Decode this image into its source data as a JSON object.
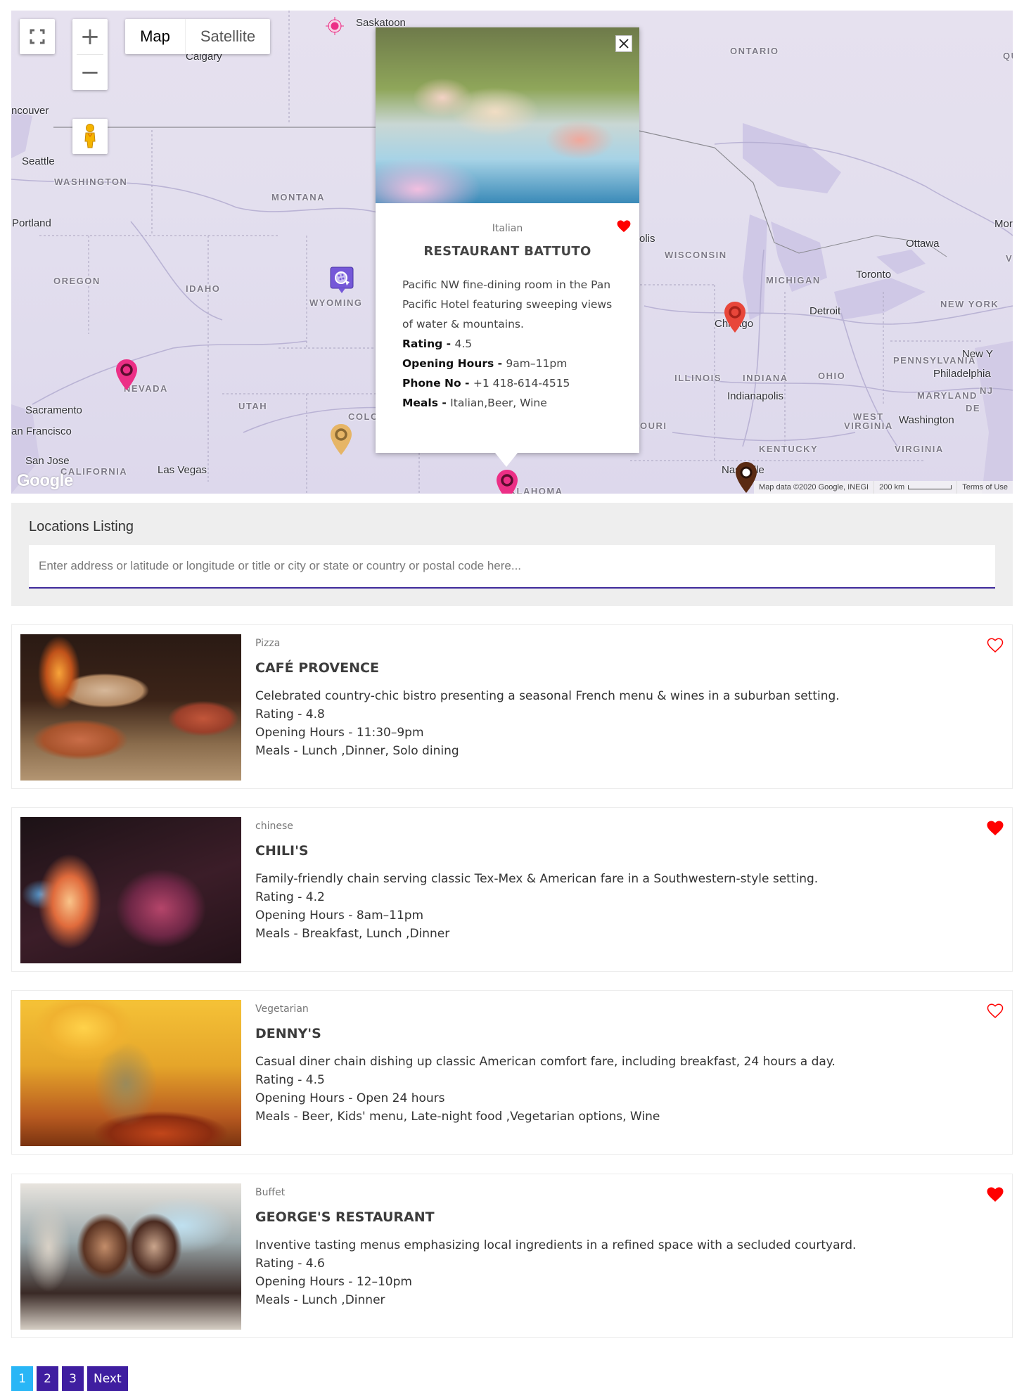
{
  "map": {
    "controls": {
      "fullscreen_icon": "fullscreen-icon",
      "zoom_in_label": "+",
      "zoom_out_label": "−",
      "pegman_icon": "street-view-pegman-icon",
      "map_type": {
        "active": "Map",
        "inactive": "Satellite"
      }
    },
    "labels": {
      "states": [
        "WASHINGTON",
        "MONTANA",
        "OREGON",
        "IDAHO",
        "WYOMING",
        "NEVADA",
        "UTAH",
        "COLO",
        "CALIFORNIA",
        "ONTARIO",
        "QU",
        "WISCONSIN",
        "MICHIGAN",
        "NEW YORK",
        "PENNSYLVANIA",
        "ILLINOIS",
        "INDIANA",
        "OHIO",
        "MARYLAND",
        "NJ",
        "DE",
        "WEST",
        "VIRGINIA",
        "KENTUCKY",
        "VIRGINIA",
        "V",
        "OKLAHOMA",
        "OURI"
      ],
      "cities": [
        "Saskatoon",
        "Calgary",
        "ncouver",
        "Seattle",
        "Portland",
        "Sacramento",
        "an Francisco",
        "San Jose",
        "Las Vegas",
        "Ottawa",
        "Mor",
        "Toronto",
        "Detroit",
        "Chicago",
        "Indianapolis",
        "Philadelphia",
        "New Y",
        "Washington",
        "Nashville",
        "olis"
      ]
    },
    "markers": [
      {
        "name": "pink-pin-nevada",
        "color": "#ec2f86"
      },
      {
        "name": "pizza-pin-wyoming",
        "color": "#7558d8"
      },
      {
        "name": "gold-pin-colorado",
        "color": "#e6b566"
      },
      {
        "name": "red-pin-chicago",
        "color": "#e8463a"
      },
      {
        "name": "brown-pin-nashville",
        "color": "#5a2a12"
      },
      {
        "name": "pink-pin-oklahoma",
        "color": "#ec2f86"
      },
      {
        "name": "pink-target-saskatchewan",
        "color": "#ec2f86"
      }
    ],
    "logo": "Google",
    "footer": {
      "attribution": "Map data ©2020 Google, INEGI",
      "scale": "200 km",
      "terms": "Terms of Use"
    }
  },
  "popup": {
    "category": "Italian",
    "title": "RESTAURANT BATTUTO",
    "description": "Pacific NW fine-dining room in the Pan Pacific Hotel featuring sweeping views of water & mountains.",
    "fields": [
      {
        "label": "Rating - ",
        "value": "4.5"
      },
      {
        "label": "Opening Hours - ",
        "value": "9am–11pm"
      },
      {
        "label": "Phone No - ",
        "value": "+1 418-614-4515"
      },
      {
        "label": "Meals - ",
        "value": "Italian,Beer, Wine"
      }
    ],
    "favorite": true
  },
  "listing": {
    "title": "Locations Listing",
    "search_placeholder": "Enter address or latitude or longitude or title or city or state or country or postal code here...",
    "search_value": ""
  },
  "locations": [
    {
      "category": "Pizza",
      "title": "CAFÉ PROVENCE",
      "description": "Celebrated country-chic bistro presenting a seasonal French menu & wines in a suburban setting.",
      "rating": "Rating - 4.8",
      "hours": "Opening Hours - 11:30–9pm",
      "meals": "Meals - Lunch ,Dinner, Solo dining",
      "favorite": false
    },
    {
      "category": "chinese",
      "title": "CHILI'S",
      "description": "Family-friendly chain serving classic Tex-Mex & American fare in a Southwestern-style setting.",
      "rating": "Rating - 4.2",
      "hours": "Opening Hours - 8am–11pm",
      "meals": "Meals - Breakfast, Lunch ,Dinner",
      "favorite": true
    },
    {
      "category": "Vegetarian",
      "title": "DENNY'S",
      "description": "Casual diner chain dishing up classic American comfort fare, including breakfast, 24 hours a day.",
      "rating": "Rating - 4.5",
      "hours": "Opening Hours - Open 24 hours",
      "meals": "Meals - Beer, Kids' menu, Late-night food ,Vegetarian options, Wine",
      "favorite": false
    },
    {
      "category": "Buffet",
      "title": "GEORGE'S RESTAURANT",
      "description": "Inventive tasting menus emphasizing local ingredients in a refined space with a secluded courtyard.",
      "rating": "Rating - 4.6",
      "hours": "Opening Hours - 12–10pm",
      "meals": "Meals - Lunch ,Dinner",
      "favorite": true
    }
  ],
  "pagination": {
    "pages": [
      "1",
      "2",
      "3"
    ],
    "current": "1",
    "next_label": "Next"
  },
  "colors": {
    "accent": "#3f1ea0",
    "active_page": "#29b6f6",
    "heart": "#ff0000",
    "search_underline": "#3f2a9b"
  }
}
